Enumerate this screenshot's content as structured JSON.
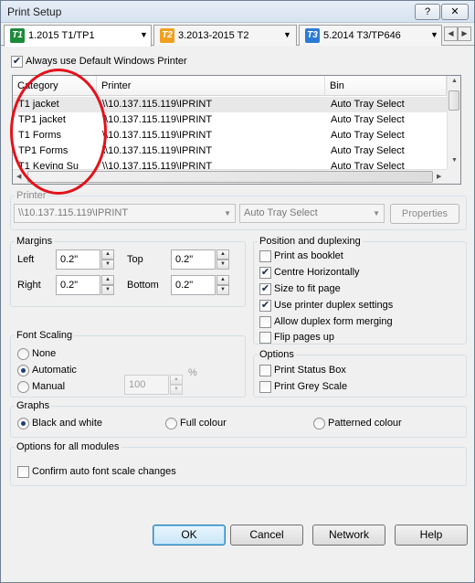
{
  "window": {
    "title": "Print Setup",
    "help_glyph": "?",
    "close_glyph": "✕"
  },
  "tabs": [
    {
      "badge": "T1",
      "label": "1.2015 T1/TP1",
      "color": "#1d8a3a"
    },
    {
      "badge": "T2",
      "label": "3.2013-2015 T2",
      "color": "#f0a020"
    },
    {
      "badge": "T3",
      "label": "5.2014 T3/TP646",
      "color": "#2b7bd4"
    }
  ],
  "tab_scroll": {
    "left": "◀",
    "right": "▶"
  },
  "always_default": {
    "label": "Always use Default Windows Printer",
    "checked": true
  },
  "printer_list": {
    "columns": [
      "Category",
      "Printer",
      "Bin"
    ],
    "rows": [
      {
        "category": "T1 jacket",
        "printer": "\\\\10.137.115.119\\IPRINT",
        "bin": "Auto Tray Select"
      },
      {
        "category": "TP1 jacket",
        "printer": "\\\\10.137.115.119\\IPRINT",
        "bin": "Auto Tray Select"
      },
      {
        "category": "T1 Forms",
        "printer": "\\\\10.137.115.119\\IPRINT",
        "bin": "Auto Tray Select"
      },
      {
        "category": "TP1 Forms",
        "printer": "\\\\10.137.115.119\\IPRINT",
        "bin": "Auto Tray Select"
      },
      {
        "category": "T1 Keying Su",
        "printer": "\\\\10.137.115.119\\IPRINT",
        "bin": "Auto Tray Select"
      }
    ]
  },
  "printer": {
    "label": "Printer",
    "value": "\\\\10.137.115.119\\IPRINT",
    "bin": "Auto Tray Select",
    "properties": "Properties"
  },
  "margins": {
    "label": "Margins",
    "left_label": "Left",
    "left": "0.2\"",
    "top_label": "Top",
    "top": "0.2\"",
    "right_label": "Right",
    "right": "0.2\"",
    "bottom_label": "Bottom",
    "bottom": "0.2\""
  },
  "position": {
    "label": "Position and duplexing",
    "items": [
      {
        "label": "Print as booklet",
        "checked": false
      },
      {
        "label": "Centre Horizontally",
        "checked": true
      },
      {
        "label": "Size to fit page",
        "checked": true
      },
      {
        "label": "Use printer duplex settings",
        "checked": true
      },
      {
        "label": "Allow duplex form merging",
        "checked": false
      },
      {
        "label": "Flip pages up",
        "checked": false
      }
    ]
  },
  "font_scaling": {
    "label": "Font Scaling",
    "none": "None",
    "automatic": "Automatic",
    "manual": "Manual",
    "value": "100",
    "unit": "%",
    "selected": "automatic"
  },
  "options": {
    "label": "Options",
    "items": [
      {
        "label": "Print Status Box",
        "checked": false
      },
      {
        "label": "Print Grey Scale",
        "checked": false
      }
    ]
  },
  "graphs": {
    "label": "Graphs",
    "bw": "Black and white",
    "full": "Full colour",
    "patterned": "Patterned colour",
    "selected": "bw"
  },
  "modules": {
    "label": "Options for all modules",
    "confirm": "Confirm auto font scale changes",
    "checked": false
  },
  "buttons": {
    "ok": "OK",
    "cancel": "Cancel",
    "network": "Network",
    "help": "Help"
  },
  "annotation_color": "#e3121b"
}
